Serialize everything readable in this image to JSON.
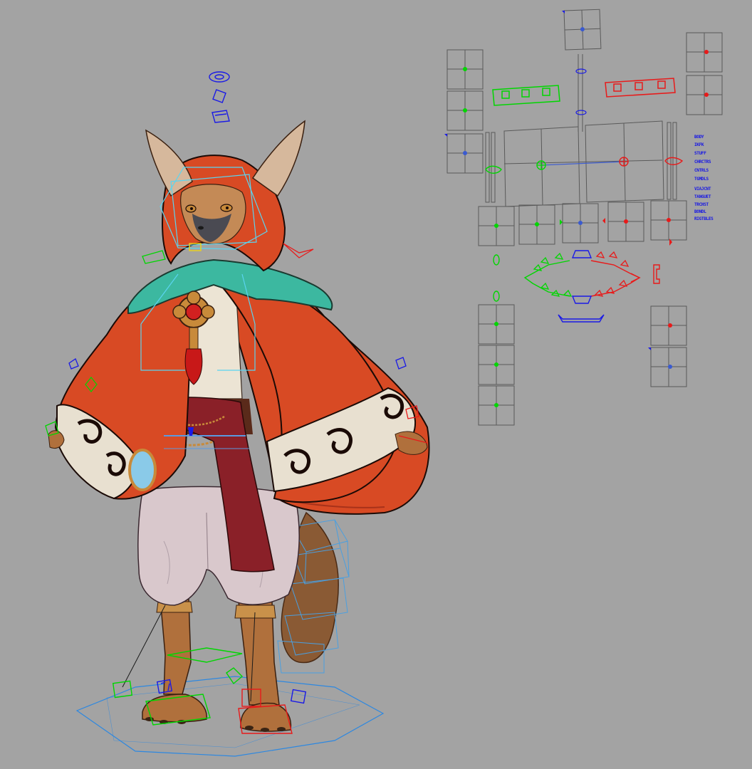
{
  "viewport": {
    "background": "#a3a3a3",
    "colors": {
      "ctrl_left": "#00d600",
      "ctrl_right": "#e81a1a",
      "ctrl_center": "#1a1ae6",
      "ctrl_frame": "#5a5a5a",
      "ctrl_dot_blue": "#3a5ad0",
      "selection_cyan": "#5ad4f0",
      "ik_cube_blue": "#1a1ae6"
    }
  },
  "character": {
    "icon": "fox-character-in-red-hooded-cloak",
    "colors": {
      "cloak": "#d84a24",
      "cloak_shadow": "#a8321a",
      "collar": "#3cb8a0",
      "fur": "#b0703c",
      "pants": "#d9c8cc",
      "sash": "#8a2028",
      "ear_inner": "#d6b89c",
      "face_mask": "#4a4a52",
      "gem": "#d22020",
      "gold": "#c88a3a"
    }
  },
  "picker": {
    "icon": "rig-control-picker-panel",
    "selection_list": [
      "BODY",
      "IKFK",
      "STUFF",
      "CHRCTRS",
      "CNTRLS",
      "TGMDLS",
      "VIAJCNT",
      "TANGUET",
      "TRCHST",
      "BONDL",
      "RIGTBLES"
    ]
  }
}
